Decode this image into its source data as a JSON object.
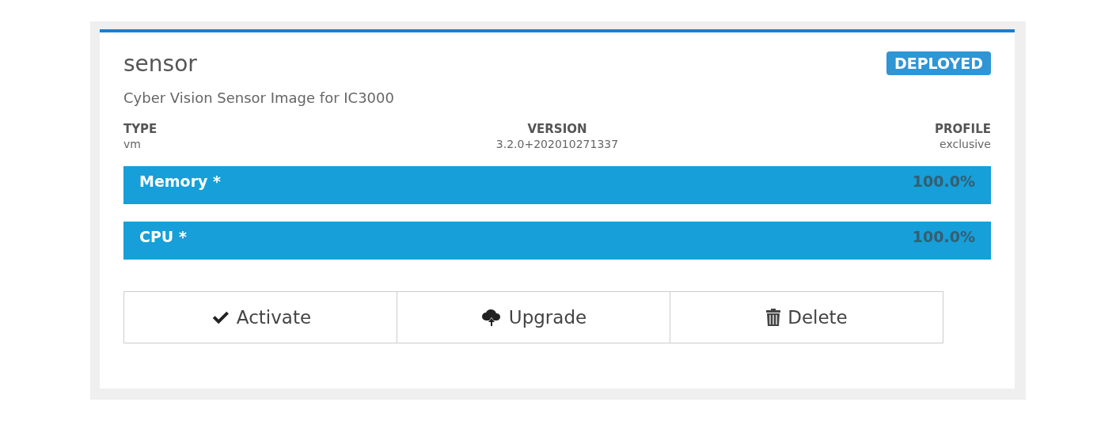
{
  "card": {
    "title": "sensor",
    "status": "DEPLOYED",
    "description": "Cyber Vision Sensor Image for IC3000",
    "fields": [
      {
        "label": "TYPE",
        "value": "vm"
      },
      {
        "label": "VERSION",
        "value": "3.2.0+202010271337"
      },
      {
        "label": "PROFILE",
        "value": "exclusive"
      }
    ],
    "resources": [
      {
        "name": "Memory *",
        "level": 1,
        "reading": "100.0%"
      },
      {
        "name": "CPU *",
        "level": 1,
        "reading": "100.0%"
      }
    ],
    "buttons": [
      {
        "label": "Activate",
        "kind": "check"
      },
      {
        "label": "Upgrade",
        "kind": "upload"
      },
      {
        "label": "Delete",
        "kind": "trash"
      }
    ]
  }
}
